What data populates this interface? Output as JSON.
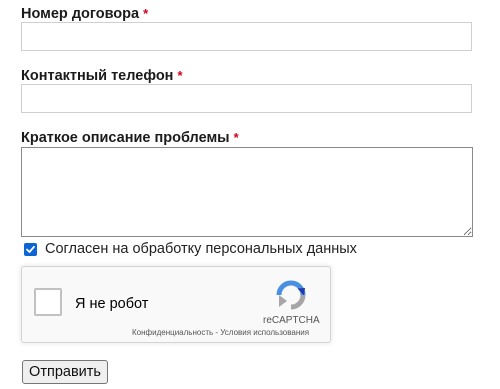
{
  "form": {
    "contract": {
      "label": "Номер договора",
      "required_mark": "*",
      "value": ""
    },
    "phone": {
      "label": "Контактный телефон",
      "required_mark": "*",
      "value": ""
    },
    "description": {
      "label": "Краткое описание проблемы",
      "required_mark": "*",
      "value": ""
    },
    "consent": {
      "label": "Согласен на обработку персональных данных",
      "checked": true
    },
    "captcha": {
      "label": "Я не робот",
      "brand": "reCAPTCHA",
      "links": "Конфиденциальность - Условия использования",
      "icon": "recaptcha-logo-icon"
    },
    "submit_label": "Отправить"
  },
  "colors": {
    "required": "#d0021b",
    "checkbox_accent": "#0b65d4",
    "captcha_blue": "#4a90e2",
    "captcha_grey": "#a6a6a6"
  }
}
